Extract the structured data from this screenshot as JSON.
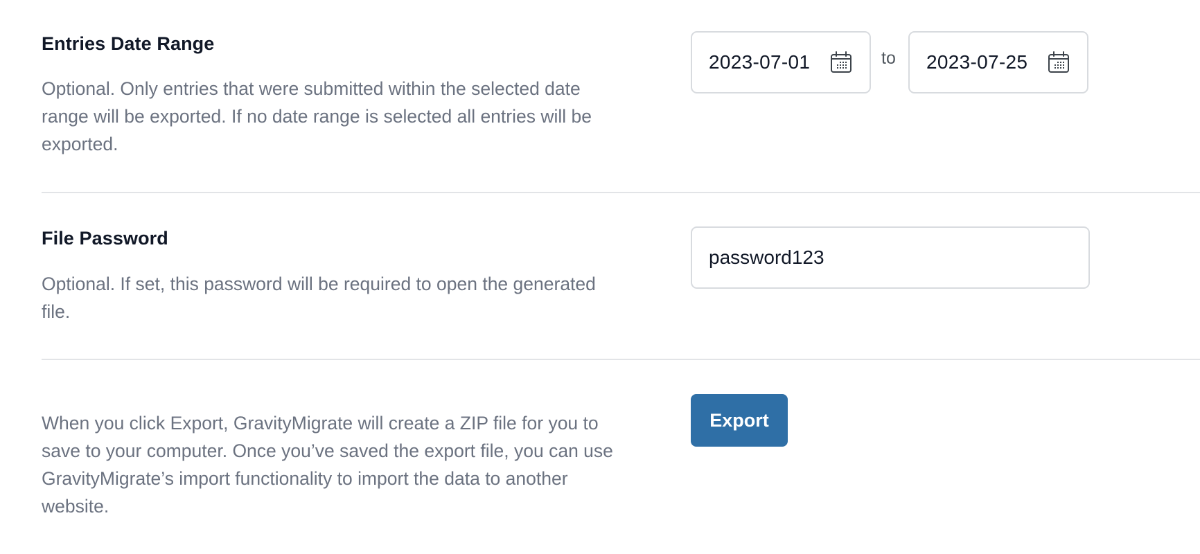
{
  "date_range": {
    "title": "Entries Date Range",
    "description": "Optional. Only entries that were submitted within the selected date range will be exported. If no date range is selected all entries will be exported.",
    "start_value": "2023-07-01",
    "separator": "to",
    "end_value": "2023-07-25",
    "icon": "calendar-icon"
  },
  "file_password": {
    "title": "File Password",
    "description": "Optional. If set, this password will be required to open the generated file.",
    "value": "password123"
  },
  "export": {
    "description": "When you click Export, GravityMigrate will create a ZIP file for you to save to your computer. Once you’ve saved the export file, you can use GravityMigrate’s import functionality to import the data to another website.",
    "button_label": "Export",
    "button_color": "#2f6fa6"
  },
  "colors": {
    "title_text": "#111827",
    "description_text": "#6b7280",
    "input_border": "#d8dbdf",
    "divider": "#e2e4e7"
  }
}
